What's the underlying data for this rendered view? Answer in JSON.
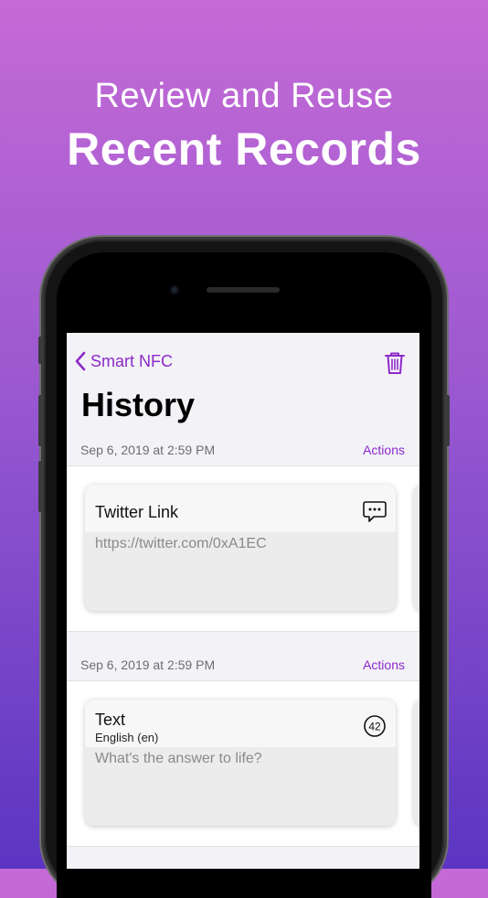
{
  "headline": {
    "line1": "Review and Reuse",
    "line2": "Recent Records"
  },
  "nav": {
    "back_label": "Smart NFC",
    "title": "History"
  },
  "sections": [
    {
      "date": "Sep 6, 2019 at 2:59 PM",
      "actions_label": "Actions",
      "card": {
        "title": "Twitter Link",
        "subtitle": "",
        "body": "https://twitter.com/0xA1EC",
        "icon": "message-bubble-icon"
      }
    },
    {
      "date": "Sep 6, 2019 at 2:59 PM",
      "actions_label": "Actions",
      "card": {
        "title": "Text",
        "subtitle": "English (en)",
        "body": "What's the answer to life?",
        "icon_value": "42"
      }
    }
  ],
  "colors": {
    "accent": "#8e2ac9",
    "background_top": "#c56ad6",
    "background_bottom": "#5b35c2"
  }
}
